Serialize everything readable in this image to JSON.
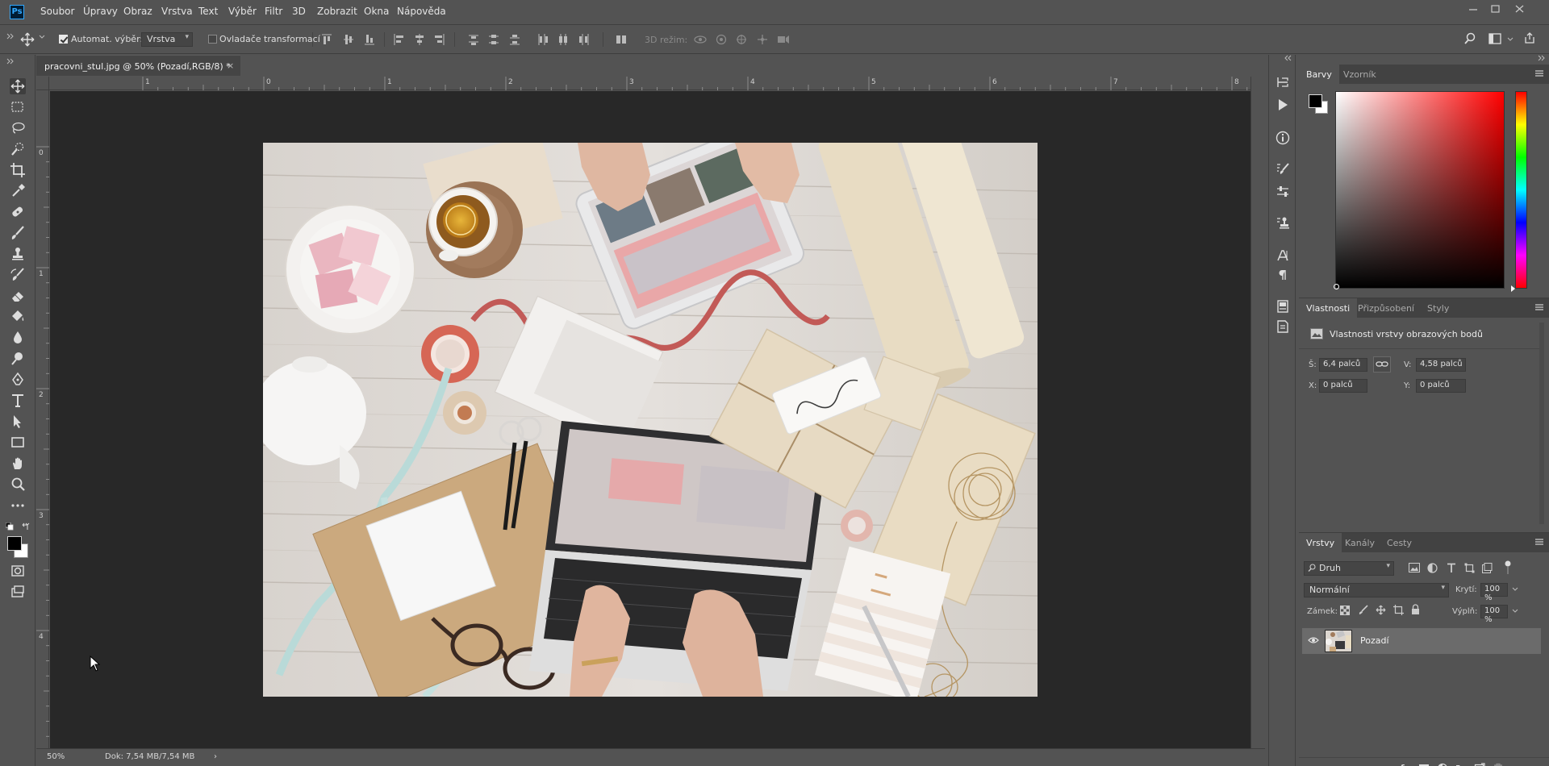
{
  "app": {
    "logo": "Ps"
  },
  "menu": [
    "Soubor",
    "Úpravy",
    "Obraz",
    "Vrstva",
    "Text",
    "Výběr",
    "Filtr",
    "3D",
    "Zobrazit",
    "Okna",
    "Nápověda"
  ],
  "options": {
    "auto_select_label": "Automat. výběr:",
    "auto_select_value": "Vrstva",
    "transform_controls_label": "Ovladače transformací",
    "mode_3d_label": "3D režim:"
  },
  "document": {
    "tab_title": "pracovni_stul.jpg @ 50% (Pozadí,RGB/8) *",
    "close": "×",
    "ruler_h": [
      "1",
      "0",
      "1",
      "2",
      "3",
      "4",
      "5",
      "6",
      "7",
      "8"
    ],
    "ruler_v": [
      "0",
      "1",
      "2",
      "3",
      "4"
    ],
    "zoom": "50%",
    "doc_size": "Dok: 7,54 MB/7,54 MB",
    "status_arrow": "›"
  },
  "color_panel": {
    "tabs": [
      "Barvy",
      "Vzorník"
    ],
    "accent_hue": "#ff0000"
  },
  "properties_panel": {
    "tabs": [
      "Vlastnosti",
      "Přizpůsobení",
      "Styly"
    ],
    "heading": "Vlastnosti vrstvy obrazových bodů",
    "width_label": "Š:",
    "width_value": "6,4 palců",
    "height_label": "V:",
    "height_value": "4,58 palců",
    "x_label": "X:",
    "x_value": "0 palců",
    "y_label": "Y:",
    "y_value": "0 palců"
  },
  "layers_panel": {
    "tabs": [
      "Vrstvy",
      "Kanály",
      "Cesty"
    ],
    "filter_value": "Druh",
    "blend_mode": "Normální",
    "opacity_label": "Krytí:",
    "opacity_value": "100 %",
    "lock_label": "Zámek:",
    "fill_label": "Výplň:",
    "fill_value": "100 %",
    "layers": [
      {
        "name": "Pozadí",
        "visible": true
      }
    ]
  }
}
